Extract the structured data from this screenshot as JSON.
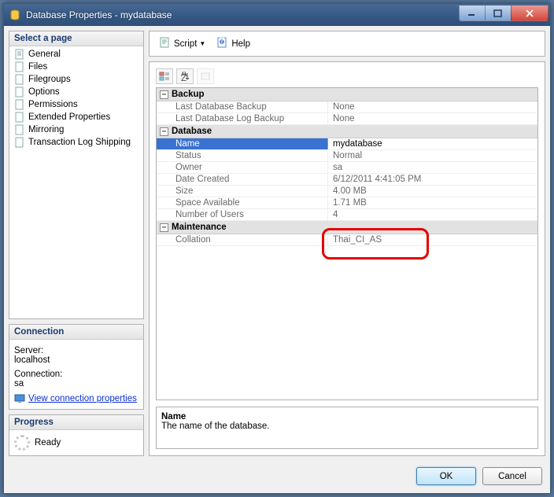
{
  "window": {
    "title": "Database Properties - mydatabase"
  },
  "left": {
    "select_page": "Select a page",
    "pages": [
      "General",
      "Files",
      "Filegroups",
      "Options",
      "Permissions",
      "Extended Properties",
      "Mirroring",
      "Transaction Log Shipping"
    ],
    "connection_hd": "Connection",
    "server_label": "Server:",
    "server_value": "localhost",
    "conn_label": "Connection:",
    "conn_value": "sa",
    "view_conn": "View connection properties",
    "progress_hd": "Progress",
    "progress_state": "Ready"
  },
  "toolbar": {
    "script": "Script",
    "help": "Help"
  },
  "grid": {
    "cat_backup": "Backup",
    "last_db_backup_k": "Last Database Backup",
    "last_db_backup_v": "None",
    "last_log_backup_k": "Last Database Log Backup",
    "last_log_backup_v": "None",
    "cat_database": "Database",
    "name_k": "Name",
    "name_v": "mydatabase",
    "status_k": "Status",
    "status_v": "Normal",
    "owner_k": "Owner",
    "owner_v": "sa",
    "date_k": "Date Created",
    "date_v": "6/12/2011 4:41:05 PM",
    "size_k": "Size",
    "size_v": "4.00 MB",
    "space_k": "Space Available",
    "space_v": "1.71 MB",
    "users_k": "Number of Users",
    "users_v": "4",
    "cat_maint": "Maintenance",
    "coll_k": "Collation",
    "coll_v": "Thai_CI_AS"
  },
  "desc": {
    "name": "Name",
    "text": "The name of the database."
  },
  "footer": {
    "ok": "OK",
    "cancel": "Cancel"
  }
}
